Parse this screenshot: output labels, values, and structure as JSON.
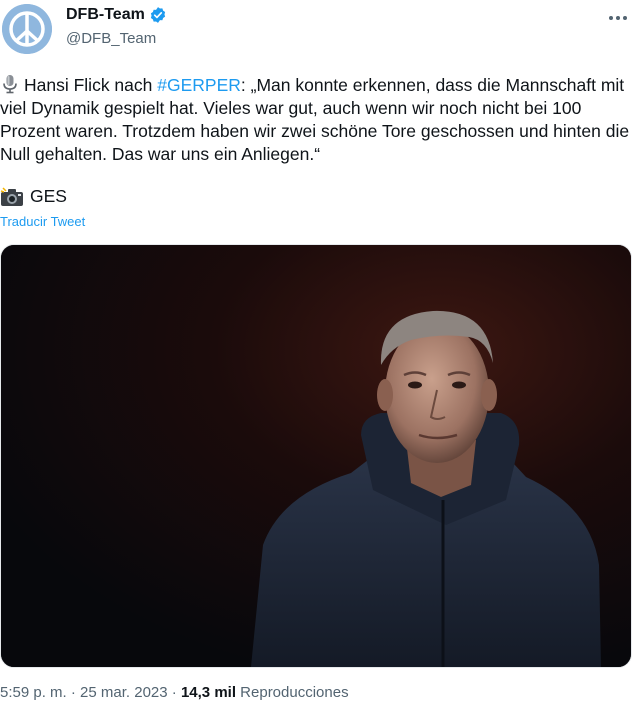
{
  "account": {
    "display_name": "DFB-Team",
    "handle": "@DFB_Team"
  },
  "tweet": {
    "text_before_hashtag": "Hansi Flick nach ",
    "hashtag": "#GERPER",
    "text_after_hashtag": ": „Man konnte erkennen, dass die Mannschaft mit viel Dynamik gespielt hat. Vieles war gut, auch wenn wir noch nicht bei 100 Prozent waren. Trotzdem haben wir zwei schöne Tore geschossen und hinten die Null gehalten. Das war uns ein Anliegen.“",
    "photo_credit": "GES",
    "translate_label": "Traducir Tweet"
  },
  "meta": {
    "time": "5:59 p. m.",
    "separator": "·",
    "date": "25 mar. 2023",
    "views_count": "14,3 mil",
    "views_label": "Reproducciones"
  },
  "icons": {
    "avatar": "peace-sign-icon",
    "verified": "verified-badge-icon",
    "more": "more-options-icon",
    "mic": "microphone-icon",
    "camera": "camera-flash-icon"
  },
  "colors": {
    "accent": "#1d9bf0",
    "text": "#0f1419",
    "secondary": "#536471",
    "avatar_bg": "#8fb7de"
  }
}
